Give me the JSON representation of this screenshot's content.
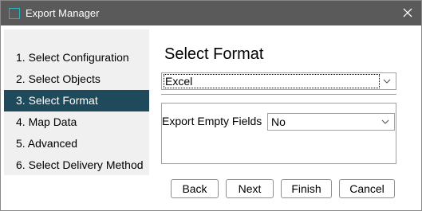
{
  "window": {
    "title": "Export Manager"
  },
  "steps": [
    {
      "label": "1. Select Configuration",
      "active": false
    },
    {
      "label": "2. Select Objects",
      "active": false
    },
    {
      "label": "3. Select Format",
      "active": true
    },
    {
      "label": "4. Map Data",
      "active": false
    },
    {
      "label": "5. Advanced",
      "active": false
    },
    {
      "label": "6. Select Delivery Method",
      "active": false
    }
  ],
  "main": {
    "heading": "Select Format",
    "format_value": "Excel",
    "export_empty_label": "Export Empty Fields",
    "export_empty_value": "No"
  },
  "buttons": {
    "back": "Back",
    "next": "Next",
    "finish": "Finish",
    "cancel": "Cancel"
  },
  "colors": {
    "titlebar": "#5a5a5a",
    "active_step": "#1e4a5c",
    "icon_accent": "#2bb3bf"
  },
  "icons": {
    "app": "app-icon",
    "close": "close-icon",
    "dropdown": "chevron-down-icon"
  }
}
